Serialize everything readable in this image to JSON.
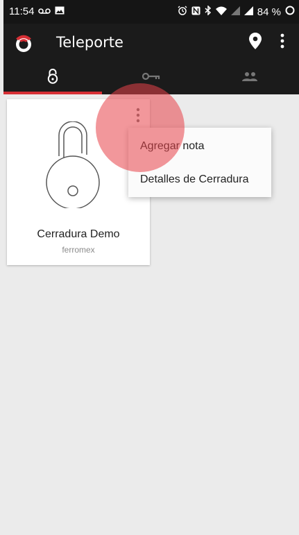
{
  "status_bar": {
    "time": "11:54",
    "battery": "84 %"
  },
  "app_bar": {
    "title": "Teleporte"
  },
  "tabs": [
    {
      "icon": "padlock-icon",
      "active": true
    },
    {
      "icon": "key-icon",
      "active": false
    },
    {
      "icon": "people-icon",
      "active": false
    }
  ],
  "lock_card": {
    "title": "Cerradura Demo",
    "subtitle": "ferromex"
  },
  "menu": {
    "items": [
      "Agregar nota",
      "Detalles de Cerradura"
    ]
  },
  "colors": {
    "accent": "#d62f35",
    "appbar": "#1b1b1b",
    "background": "#ebebeb"
  }
}
